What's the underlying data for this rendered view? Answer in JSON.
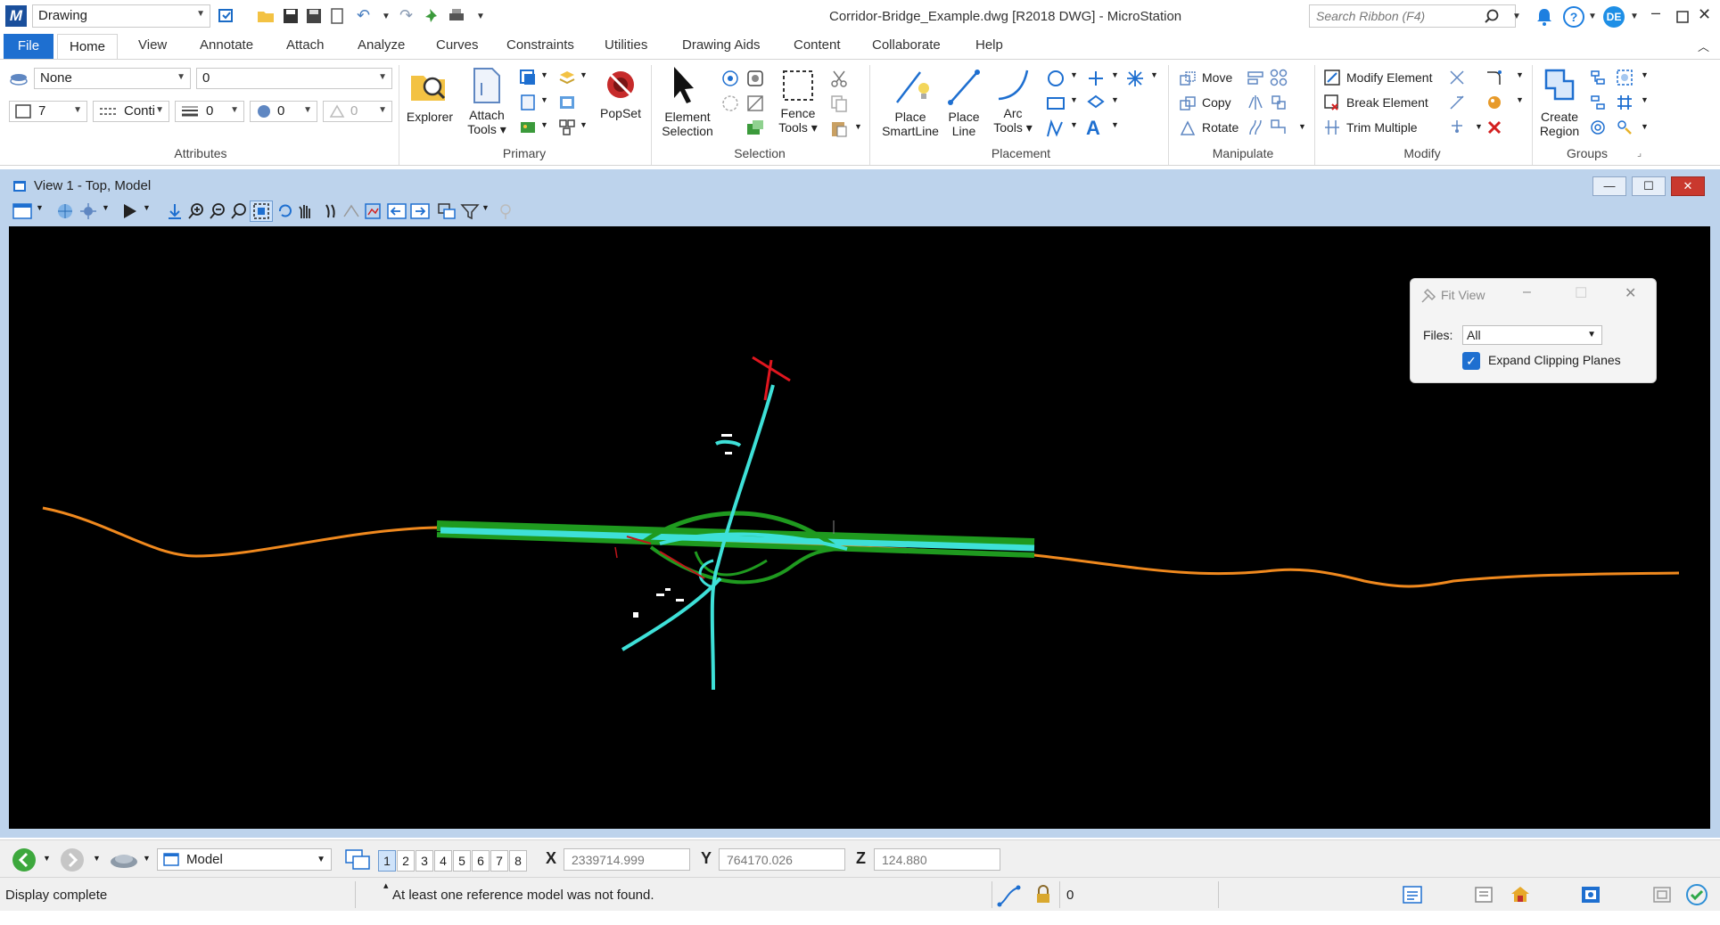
{
  "app": {
    "title": "Corridor-Bridge_Example.dwg [R2018 DWG] - MicroStation",
    "workflow": "Drawing",
    "search_placeholder": "Search Ribbon (F4)",
    "user_initials": "DE"
  },
  "tabs": [
    "File",
    "Home",
    "View",
    "Annotate",
    "Attach",
    "Analyze",
    "Curves",
    "Constraints",
    "Utilities",
    "Drawing Aids",
    "Content",
    "Collaborate",
    "Help"
  ],
  "ribbon": {
    "attributes": {
      "label": "Attributes",
      "level": "None",
      "color": "0",
      "weight": "7",
      "style": "Conti",
      "line_weight": "0",
      "transparency": "0",
      "priority": "0"
    },
    "primary": {
      "label": "Primary",
      "explorer": "Explorer",
      "attach_tools_1": "Attach",
      "attach_tools_2": "Tools",
      "popset": "PopSet"
    },
    "selection": {
      "label": "Selection",
      "element_selection_1": "Element",
      "element_selection_2": "Selection",
      "fence_tools_1": "Fence",
      "fence_tools_2": "Tools"
    },
    "placement": {
      "label": "Placement",
      "smartline_1": "Place",
      "smartline_2": "SmartLine",
      "line_1": "Place",
      "line_2": "Line",
      "arc_1": "Arc",
      "arc_2": "Tools"
    },
    "manipulate": {
      "label": "Manipulate",
      "move": "Move",
      "copy": "Copy",
      "rotate": "Rotate"
    },
    "modify": {
      "label": "Modify",
      "modify_element": "Modify Element",
      "break_element": "Break Element",
      "trim_multiple": "Trim Multiple"
    },
    "groups": {
      "label": "Groups",
      "create_region_1": "Create",
      "create_region_2": "Region"
    }
  },
  "view": {
    "title": "View 1 - Top, Model"
  },
  "fit_view": {
    "title": "Fit View",
    "files_label": "Files:",
    "files_value": "All",
    "expand_label": "Expand Clipping Planes",
    "expand_checked": true
  },
  "bottom": {
    "model": "Model",
    "view_numbers": [
      "1",
      "2",
      "3",
      "4",
      "5",
      "6",
      "7",
      "8"
    ],
    "x_label": "X",
    "x_value": "2339714.999",
    "y_label": "Y",
    "y_value": "764170.026",
    "z_label": "Z",
    "z_value": "124.880"
  },
  "status": {
    "left": "Display complete",
    "message": "At least one reference model was not found.",
    "lock_count": "0"
  },
  "colors": {
    "accent": "#1e6fd0",
    "alignment": "#f0891e",
    "corridor": "#3ee0d8",
    "corridor_edge": "#1f9a1f",
    "red_marker": "#e0161f"
  }
}
